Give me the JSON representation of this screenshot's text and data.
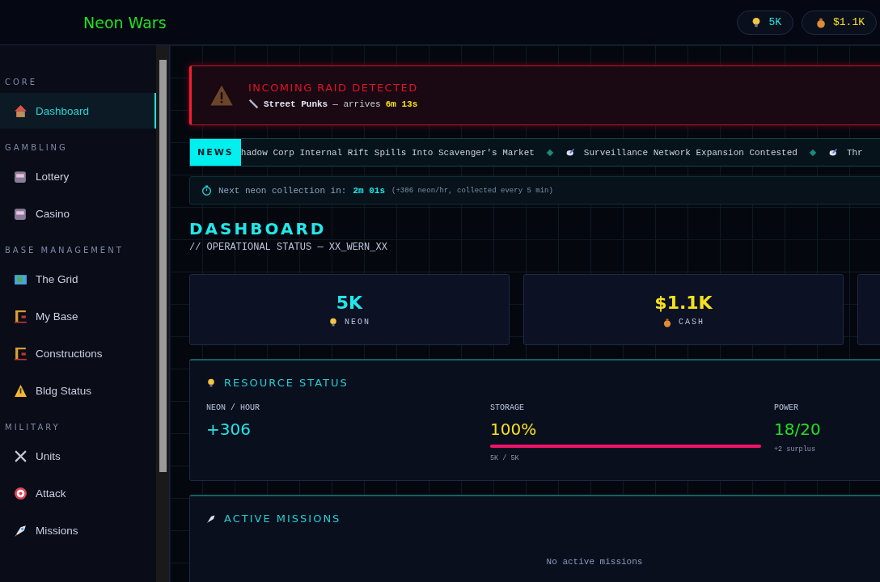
{
  "header": {
    "title": "Neon Wars",
    "resources": [
      {
        "kind": "neon",
        "value": "5K"
      },
      {
        "kind": "cash",
        "value": "$1.1K"
      }
    ]
  },
  "sidebar": {
    "sections": [
      {
        "title": "CORE",
        "items": [
          {
            "label": "Dashboard",
            "selected": true
          }
        ]
      },
      {
        "title": "GAMBLING",
        "items": [
          {
            "label": "Lottery",
            "selected": false
          },
          {
            "label": "Casino",
            "selected": false
          }
        ]
      },
      {
        "title": "BASE MANAGEMENT",
        "items": [
          {
            "label": "The Grid",
            "selected": false
          },
          {
            "label": "My Base",
            "selected": false
          },
          {
            "label": "Constructions",
            "selected": false
          },
          {
            "label": "Bldg Status",
            "selected": false
          }
        ]
      },
      {
        "title": "MILITARY",
        "items": [
          {
            "label": "Units",
            "selected": false
          },
          {
            "label": "Attack",
            "selected": false
          },
          {
            "label": "Missions",
            "selected": false
          }
        ]
      }
    ]
  },
  "raid_alert": {
    "title": "INCOMING RAID DETECTED",
    "attacker": "Street Punks",
    "arrives_label": "— arrives",
    "eta": "6m 13s"
  },
  "news": {
    "label": "NEWS",
    "items": [
      "hadow Corp Internal Rift Spills Into Scavenger's Market",
      "Surveillance Network Expansion Contested",
      "Thr"
    ]
  },
  "collection": {
    "label": "Next neon collection in:",
    "time": "2m 01s",
    "note": "(+306 neon/hr, collected every 5 min)"
  },
  "page": {
    "title": "DASHBOARD",
    "subtitle": "// OPERATIONAL STATUS — XX_WERN_XX"
  },
  "stats": [
    {
      "kind": "neon",
      "value": "5K",
      "label": "NEON"
    },
    {
      "kind": "cash",
      "value": "$1.1K",
      "label": "CASH"
    },
    {
      "kind": "empty"
    }
  ],
  "resource_status": {
    "title": "RESOURCE STATUS",
    "columns": [
      {
        "kind": "plain",
        "label": "NEON / HOUR",
        "value": "+306"
      },
      {
        "kind": "bar",
        "label": "STORAGE",
        "value": "100%",
        "level": 1.0,
        "note": "5K / 5K"
      },
      {
        "kind": "power",
        "label": "POWER",
        "value": "18/20",
        "note": "+2 surplus"
      }
    ]
  },
  "missions": {
    "title": "ACTIVE MISSIONS",
    "empty_text": "No active missions"
  }
}
